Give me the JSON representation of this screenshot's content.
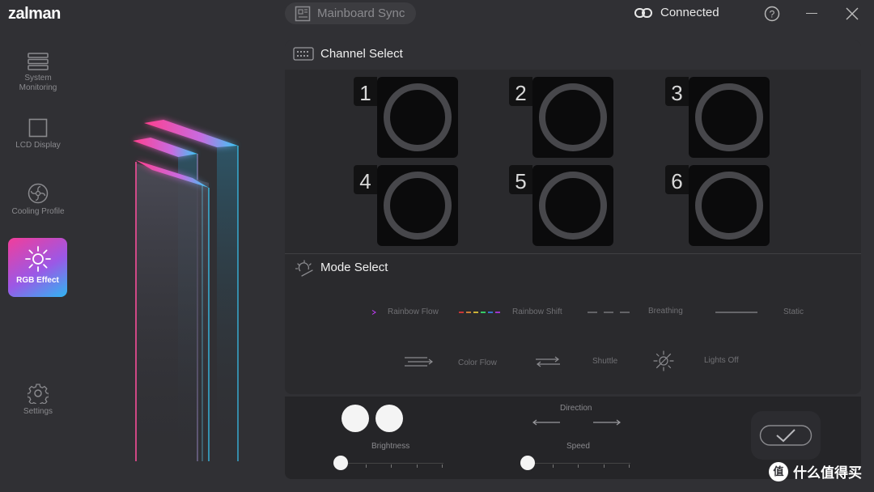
{
  "app": {
    "logo": "zalman"
  },
  "header": {
    "sync_label": "Mainboard Sync",
    "connection_status": "Connected"
  },
  "sidebar": {
    "items": [
      {
        "label": "System Monitoring",
        "icon": "monitoring-icon"
      },
      {
        "label": "LCD Display",
        "icon": "lcd-icon"
      },
      {
        "label": "Cooling Profile",
        "icon": "fan-icon"
      },
      {
        "label": "RGB Effect",
        "icon": "sun-icon",
        "active": true
      },
      {
        "label": "Settings",
        "icon": "gear-icon"
      }
    ]
  },
  "channel_select": {
    "title": "Channel Select",
    "channels": [
      "1",
      "2",
      "3",
      "4",
      "5",
      "6"
    ]
  },
  "mode_select": {
    "title": "Mode Select",
    "modes": [
      "Rainbow Flow",
      "Rainbow Shift",
      "Breathing",
      "Static",
      "Color Flow",
      "Shuttle",
      "Lights Off"
    ]
  },
  "controls": {
    "brightness_label": "Brightness",
    "speed_label": "Speed",
    "direction_label": "Direction",
    "brightness_level": 0,
    "speed_level": 0
  },
  "watermark": {
    "badge": "值",
    "text": "什么值得买"
  },
  "colors": {
    "accent_pink": "#f23d9a",
    "accent_blue": "#2fb6f2",
    "background": "#303034"
  }
}
